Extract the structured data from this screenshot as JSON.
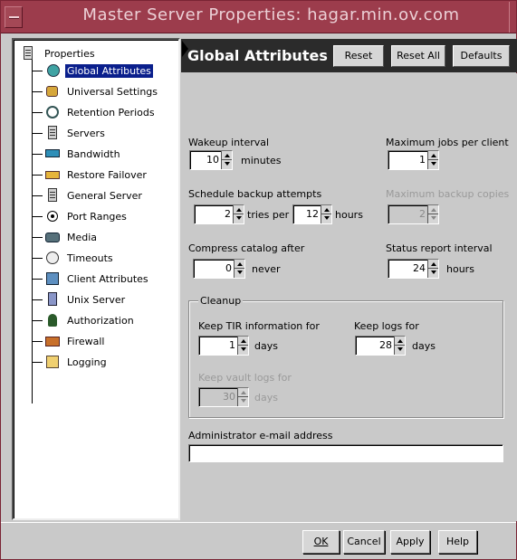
{
  "window": {
    "title": "Master Server Properties: hagar.min.ov.com"
  },
  "tree": {
    "root_label": "Properties",
    "items": [
      {
        "label": "Global Attributes",
        "icon": "globe-icon",
        "selected": true
      },
      {
        "label": "Universal Settings",
        "icon": "gears-icon"
      },
      {
        "label": "Retention Periods",
        "icon": "clock-icon"
      },
      {
        "label": "Servers",
        "icon": "server-icon"
      },
      {
        "label": "Bandwidth",
        "icon": "bandwidth-icon"
      },
      {
        "label": "Restore Failover",
        "icon": "failover-icon"
      },
      {
        "label": "General Server",
        "icon": "server-icon"
      },
      {
        "label": "Port Ranges",
        "icon": "port-icon"
      },
      {
        "label": "Media",
        "icon": "media-icon"
      },
      {
        "label": "Timeouts",
        "icon": "timeout-icon"
      },
      {
        "label": "Client Attributes",
        "icon": "client-icon"
      },
      {
        "label": "Unix Server",
        "icon": "unix-server-icon"
      },
      {
        "label": "Authorization",
        "icon": "authorization-icon"
      },
      {
        "label": "Firewall",
        "icon": "firewall-icon"
      },
      {
        "label": "Logging",
        "icon": "logging-icon"
      }
    ]
  },
  "header": {
    "title": "Global Attributes",
    "reset_label": "Reset",
    "reset_all_label": "Reset All",
    "defaults_label": "Defaults"
  },
  "form": {
    "wakeup_label": "Wakeup interval",
    "wakeup_value": "10",
    "wakeup_unit": "minutes",
    "max_jobs_label": "Maximum jobs per client",
    "max_jobs_value": "1",
    "schedule_label": "Schedule backup attempts",
    "schedule_tries_value": "2",
    "schedule_tries_unit": "tries per",
    "schedule_hours_value": "12",
    "schedule_hours_unit": "hours",
    "max_copies_label": "Maximum backup copies",
    "max_copies_value": "2",
    "compress_label": "Compress catalog after",
    "compress_value": "0",
    "compress_unit": "never",
    "status_label": "Status report interval",
    "status_value": "24",
    "status_unit": "hours",
    "cleanup_title": "Cleanup",
    "tir_label": "Keep TIR information for",
    "tir_value": "1",
    "tir_unit": "days",
    "logs_label": "Keep logs for",
    "logs_value": "28",
    "logs_unit": "days",
    "vault_label": "Keep vault logs for",
    "vault_value": "30",
    "vault_unit": "days",
    "email_label": "Administrator e-mail address",
    "email_value": ""
  },
  "footer": {
    "ok_label": "OK",
    "cancel_label": "Cancel",
    "apply_label": "Apply",
    "help_label": "Help"
  },
  "colors": {
    "titlebar": "#9c3c4c",
    "selection": "#0a1f8c",
    "header_bar": "#2b2b2b"
  }
}
